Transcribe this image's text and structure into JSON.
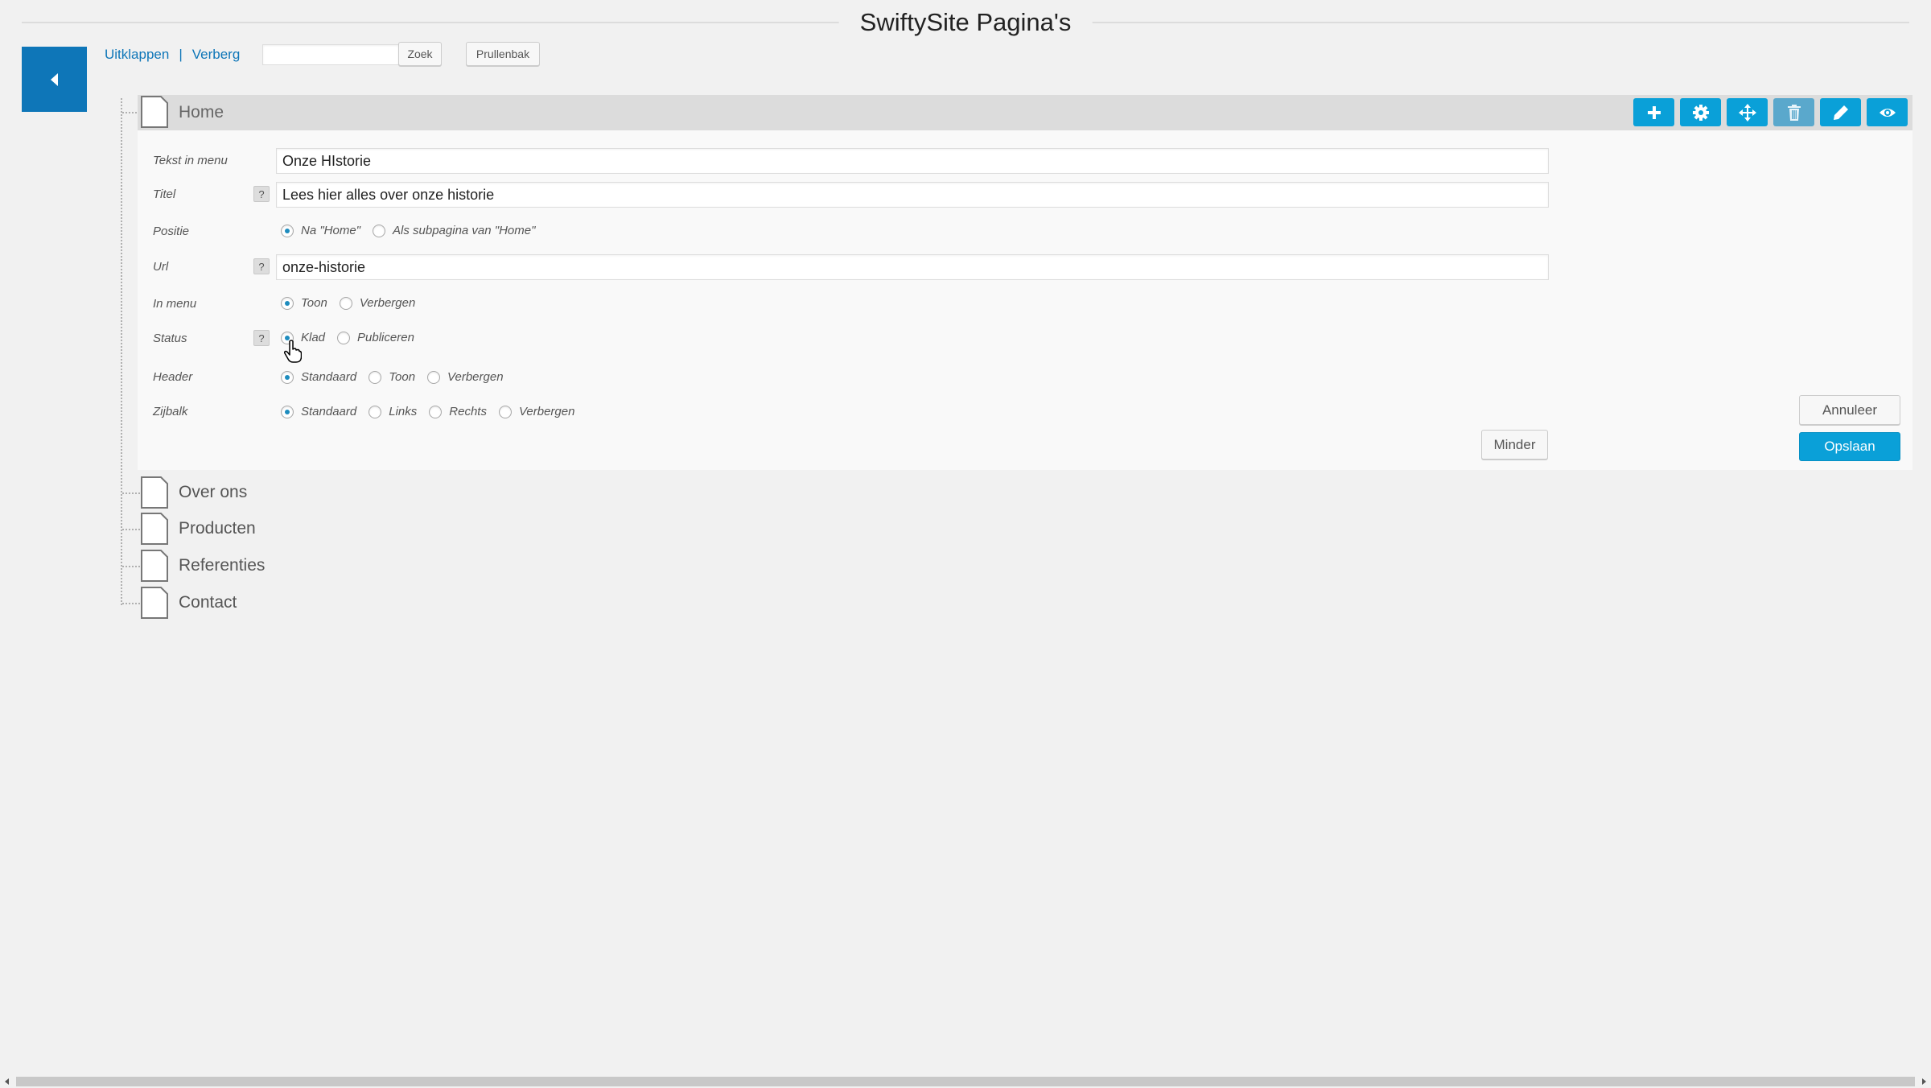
{
  "page": {
    "title": "SwiftySite Pagina's"
  },
  "toolbar": {
    "expand_label": "Uitklappen",
    "separator": "|",
    "hide_label": "Verberg",
    "search_value": "",
    "search_label": "Zoek",
    "trash_label": "Prullenbak"
  },
  "tree": {
    "home": "Home",
    "items": [
      "Over ons",
      "Producten",
      "Referenties",
      "Contact"
    ]
  },
  "actions": [
    "add-icon",
    "gear-icon",
    "move-icon",
    "trash-icon",
    "pencil-icon",
    "eye-icon"
  ],
  "form": {
    "menu_text": {
      "label": "Tekst in menu",
      "value": "Onze HIstorie"
    },
    "title": {
      "label": "Titel",
      "help": "?",
      "value": "Lees hier alles over onze historie"
    },
    "position": {
      "label": "Positie",
      "options": [
        "Na \"Home\"",
        "Als subpagina van \"Home\""
      ],
      "selected": 0
    },
    "url": {
      "label": "Url",
      "help": "?",
      "value": "onze-historie"
    },
    "in_menu": {
      "label": "In menu",
      "options": [
        "Toon",
        "Verbergen"
      ],
      "selected": 0
    },
    "status": {
      "label": "Status",
      "help": "?",
      "options": [
        "Klad",
        "Publiceren"
      ],
      "selected": 0
    },
    "header": {
      "label": "Header",
      "options": [
        "Standaard",
        "Toon",
        "Verbergen"
      ],
      "selected": 0
    },
    "sidebar": {
      "label": "Zijbalk",
      "options": [
        "Standaard",
        "Links",
        "Rechts",
        "Verbergen"
      ],
      "selected": 0
    },
    "less_label": "Minder",
    "cancel_label": "Annuleer",
    "save_label": "Opslaan"
  },
  "colors": {
    "primary": "#0e76b8",
    "action": "#0aa0d8",
    "radio_on": "#1e8cbe"
  }
}
